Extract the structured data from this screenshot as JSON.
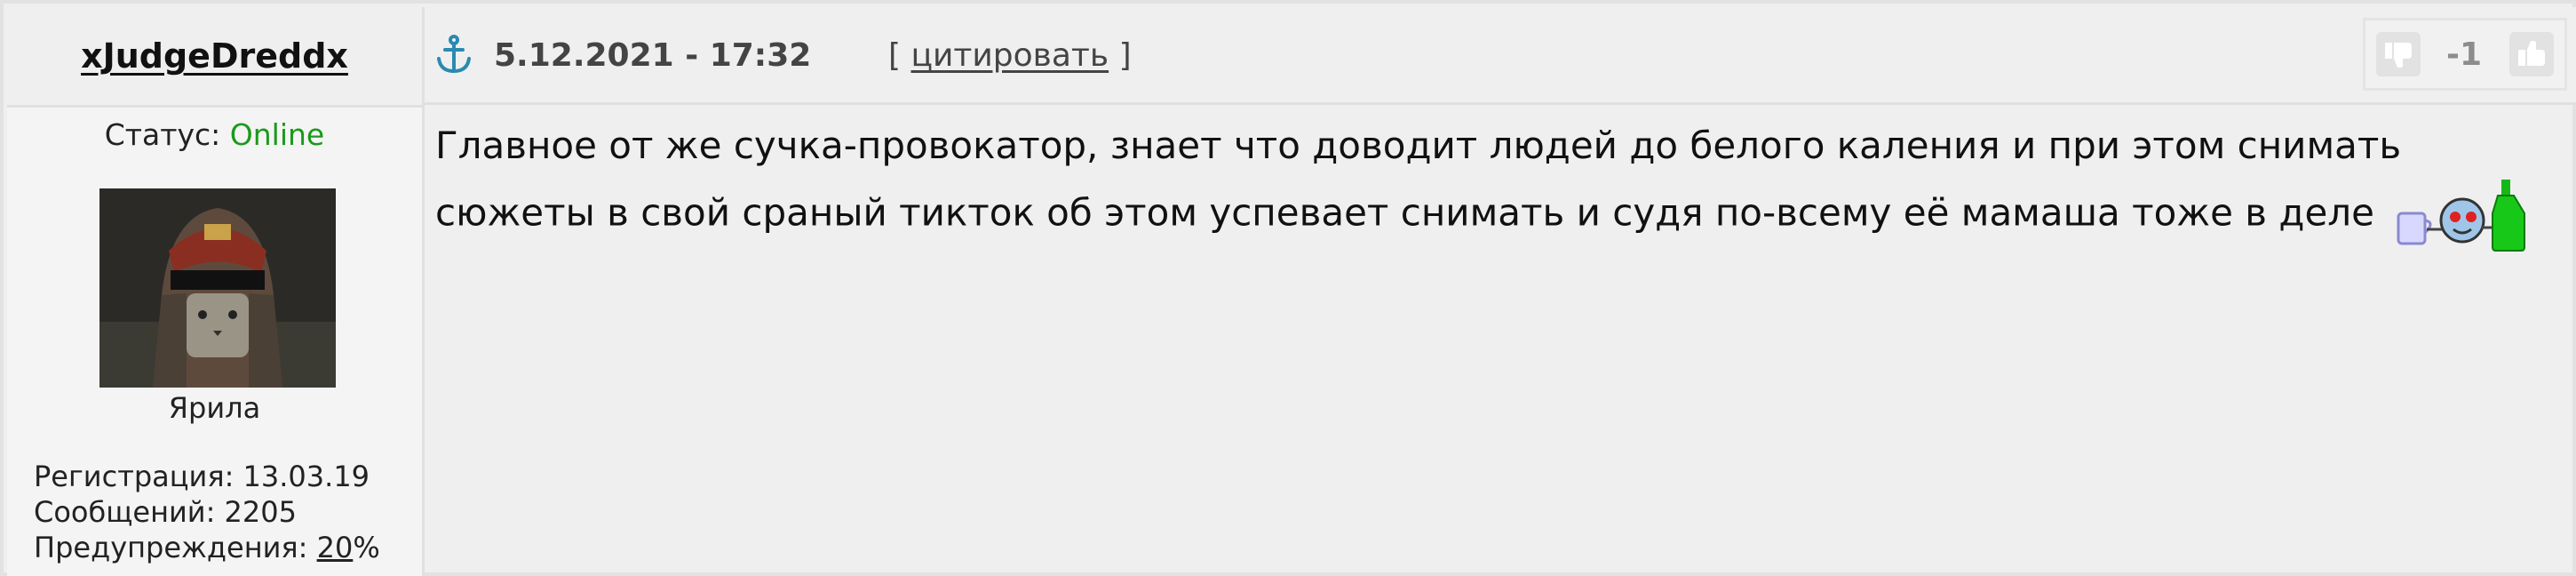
{
  "author": {
    "username": "xJudgeDreddx",
    "status_label": "Статус:",
    "status_value": "Online",
    "rank": "Ярила",
    "registration_label": "Регистрация:",
    "registration_value": "13.03.19",
    "messages_label": "Сообщений:",
    "messages_value": "2205",
    "warnings_label": "Предупреждения:",
    "warnings_value": "20",
    "warnings_unit": "%"
  },
  "post": {
    "date": "5.12.2021 - 17:32",
    "quote_open": "[",
    "quote_label": "цитировать",
    "quote_close": "]",
    "rating": "-1",
    "text": "Главное от же сучка-провокатор, знает что доводит людей до белого каления и при этом снимать сюжеты в свой сраный тикток об этом успевает снимать и судя по-всему её мамаша тоже в деле"
  },
  "icons": {
    "anchor": "anchor-icon",
    "thumb_down": "thumb-down-icon",
    "thumb_up": "thumb-up-icon",
    "smiley": "drinking-smiley-icon"
  },
  "colors": {
    "online": "#1a9a1a",
    "anchor": "#2a8ab0",
    "rating": "#8c8c8c"
  }
}
